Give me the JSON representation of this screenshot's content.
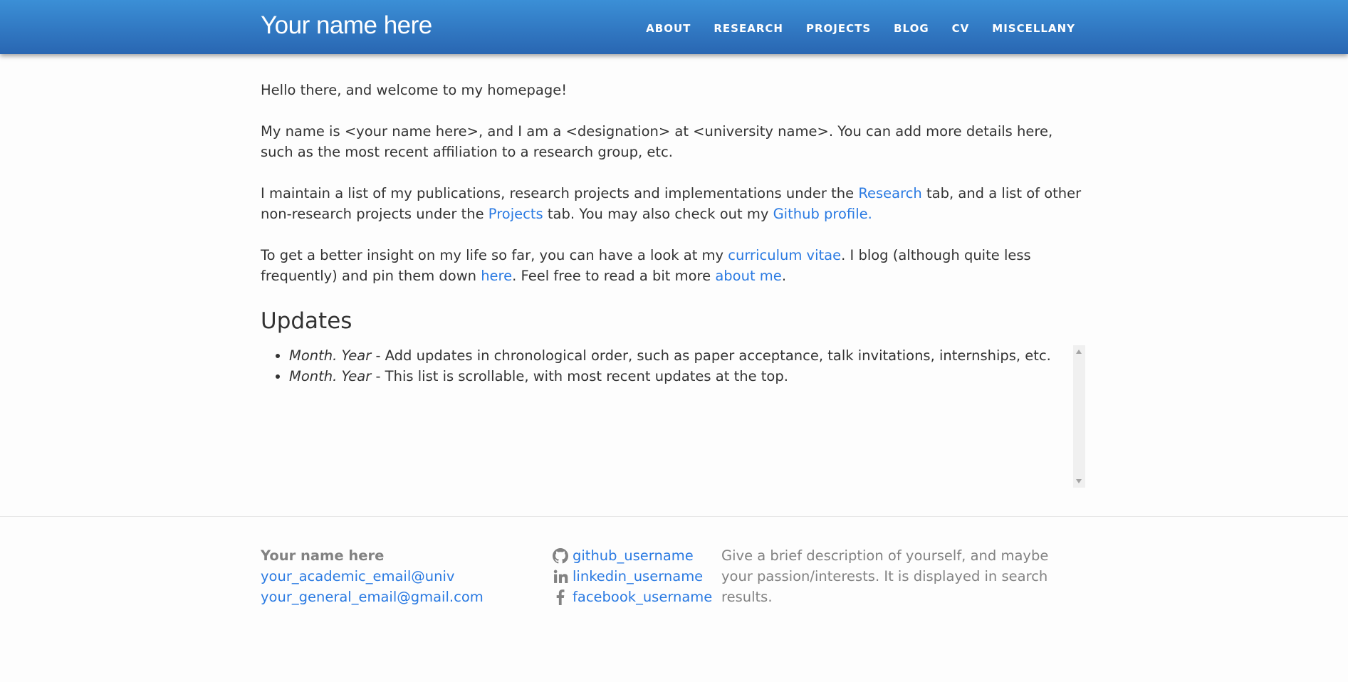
{
  "header": {
    "site_title": "Your name here",
    "nav": [
      "ABOUT",
      "RESEARCH",
      "PROJECTS",
      "BLOG",
      "CV",
      "MISCELLANY"
    ]
  },
  "intro": {
    "p1": "Hello there, and welcome to my homepage!",
    "p2": "My name is <your name here>, and I am a <designation> at <university name>. You can add more details here, such as the most recent affiliation to a research group, etc.",
    "p3_a": "I maintain a list of my publications, research projects and implementations under the ",
    "p3_link_research": "Research",
    "p3_b": " tab, and a list of other non-research projects under the ",
    "p3_link_projects": "Projects",
    "p3_c": " tab. You may also check out my ",
    "p3_link_github": "Github profile.",
    "p4_a": "To get a better insight on my life so far, you can have a look at my ",
    "p4_link_cv": "curriculum vitae",
    "p4_b": ". I blog (although quite less frequently) and pin them down ",
    "p4_link_here": "here",
    "p4_c": ". Feel free to read a bit more ",
    "p4_link_about": "about me",
    "p4_d": "."
  },
  "updates": {
    "title": "Updates",
    "items": [
      {
        "date": "Month. Year",
        "text": " - Add updates in chronological order, such as paper acceptance, talk invitations, internships, etc."
      },
      {
        "date": "Month. Year",
        "text": " - This list is scrollable, with most recent updates at the top."
      }
    ]
  },
  "footer": {
    "name": "Your name here",
    "academic_email": "your_academic_email@univ",
    "general_email": "your_general_email@gmail.com",
    "github": "github_username",
    "linkedin": "linkedin_username",
    "facebook": "facebook_username",
    "description": "Give a brief description of yourself, and maybe your passion/interests. It is displayed in search results."
  },
  "colors": {
    "header_gradient_top": "#3b8fd6",
    "header_gradient_bottom": "#2966b2",
    "link": "#2a7ae2",
    "footer_text": "#828282"
  },
  "icons": [
    "github-icon",
    "linkedin-icon",
    "facebook-icon"
  ]
}
